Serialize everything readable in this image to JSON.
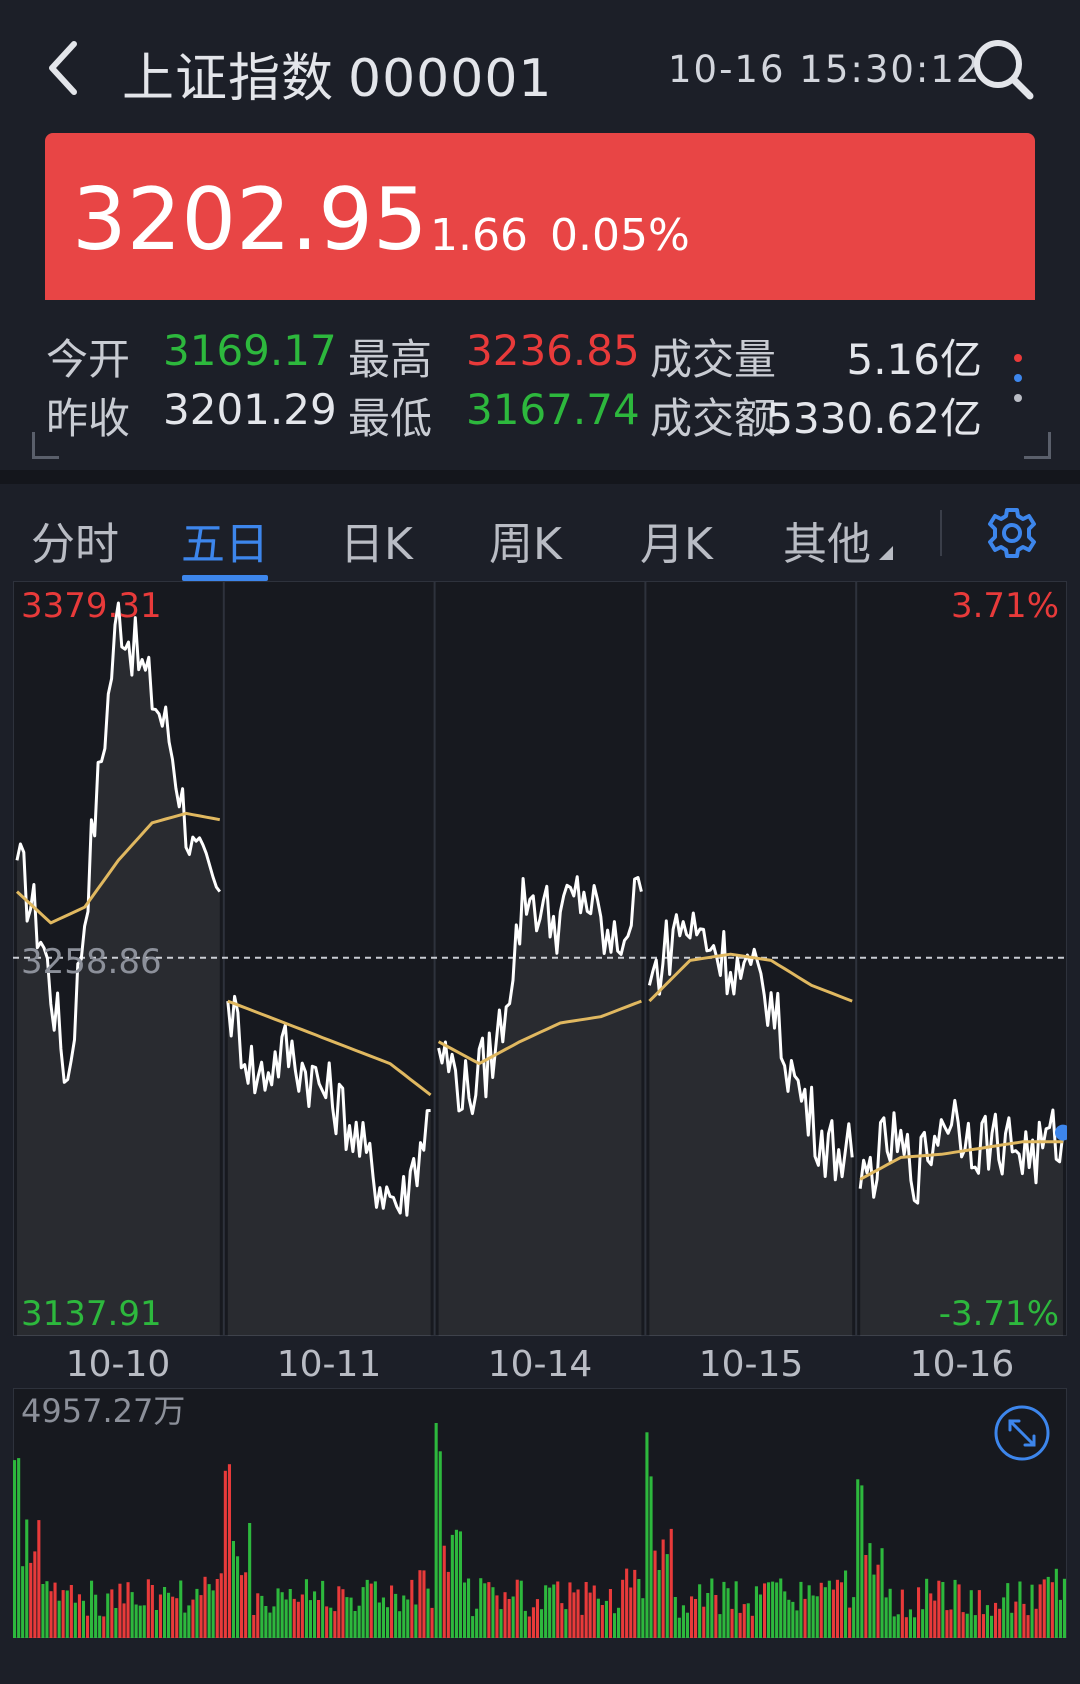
{
  "header": {
    "index_name": "上证指数",
    "index_code": "000001",
    "datetime": "10-16 15:30:12"
  },
  "quote": {
    "price": "3202.95",
    "change": "1.66",
    "change_pct": "0.05%"
  },
  "stats": {
    "open_label": "今开",
    "open_value": "3169.17",
    "high_label": "最高",
    "high_value": "3236.85",
    "volume_label": "成交量",
    "volume_value": "5.16亿",
    "prev_close_label": "昨收",
    "prev_close_value": "3201.29",
    "low_label": "最低",
    "low_value": "3167.74",
    "amount_label": "成交额",
    "amount_value": "5330.62亿"
  },
  "tabs": [
    {
      "label": "分时"
    },
    {
      "label": "五日",
      "active": true
    },
    {
      "label": "日K"
    },
    {
      "label": "周K"
    },
    {
      "label": "月K"
    },
    {
      "label": "其他"
    }
  ],
  "chart_data": {
    "type": "line",
    "x": [
      "10-10",
      "10-11",
      "10-14",
      "10-15",
      "10-16"
    ],
    "y_max_label": "3379.31",
    "y_mid_label": "3258.86",
    "y_min_label": "3137.91",
    "pct_max_label": "3.71%",
    "pct_min_label": "-3.71%",
    "ylim": [
      3137.91,
      3379.31
    ],
    "reference": 3258.86,
    "series": [
      {
        "color": "#ffffff",
        "day_values": [
          [
            3290,
            3265,
            3220,
            3300,
            3370,
            3350,
            3330,
            3290,
            3280
          ],
          [
            3245,
            3220,
            3230,
            3220,
            3210,
            3190,
            3180,
            3210
          ],
          [
            3230,
            3215,
            3230,
            3280,
            3270,
            3280,
            3260,
            3280
          ],
          [
            3250,
            3270,
            3265,
            3255,
            3250,
            3220,
            3200,
            3195
          ],
          [
            3185,
            3200,
            3190,
            3210,
            3200,
            3200,
            3195,
            3202.95
          ]
        ]
      },
      {
        "color": "#e0b860",
        "day_values": [
          [
            3280,
            3270,
            3275,
            3290,
            3302,
            3305,
            3303
          ],
          [
            3245,
            3240,
            3235,
            3230,
            3225,
            3215
          ],
          [
            3232,
            3225,
            3232,
            3238,
            3240,
            3245
          ],
          [
            3245,
            3258,
            3260,
            3258,
            3250,
            3245
          ],
          [
            3188,
            3195,
            3196,
            3198,
            3200,
            3200
          ]
        ]
      }
    ]
  },
  "volume": {
    "max_label": "4957.27万",
    "up_color": "#e83a3a",
    "down_color": "#2db83d"
  },
  "colors": {
    "banner": "#e84545",
    "up": "#e83a3a",
    "down": "#2db83d",
    "accent": "#3d86ec"
  }
}
